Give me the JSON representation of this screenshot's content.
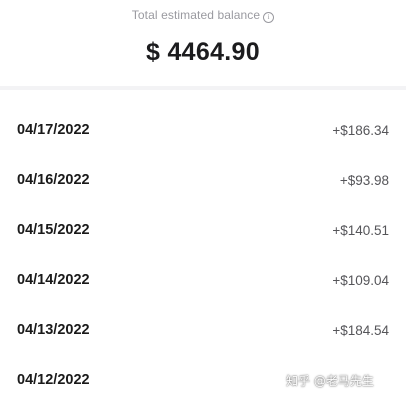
{
  "balance": {
    "label": "Total estimated balance",
    "amount": "$ 4464.90"
  },
  "transactions": [
    {
      "date": "04/17/2022",
      "amount": "+$186.34"
    },
    {
      "date": "04/16/2022",
      "amount": "+$93.98"
    },
    {
      "date": "04/15/2022",
      "amount": "+$140.51"
    },
    {
      "date": "04/14/2022",
      "amount": "+$109.04"
    },
    {
      "date": "04/13/2022",
      "amount": "+$184.54"
    },
    {
      "date": "04/12/2022",
      "amount": ""
    }
  ],
  "watermark": "知乎 @老马先生"
}
